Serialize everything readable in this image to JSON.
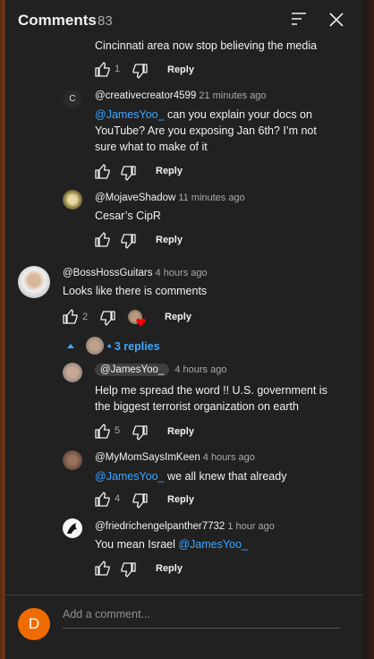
{
  "header": {
    "title": "Comments",
    "count": "83"
  },
  "comments": [
    {
      "text": "Cincinnati area now stop believing the media",
      "likes": "1",
      "reply": "Reply"
    },
    {
      "author": "@creativecreator4599",
      "time": "21 minutes ago",
      "mention": "@JamesYoo_",
      "text1": "can you explain your docs on",
      "text2": "YouTube? Are you exposing Jan 6th? I’m not",
      "text3": "sure what to make of it",
      "reply": "Reply",
      "avatar_letter": "C"
    },
    {
      "author": "@MojaveShadow",
      "time": "11 minutes ago",
      "text": "Cesar’s CipR",
      "reply": "Reply"
    },
    {
      "author": "@BossHossGuitars",
      "time": "4 hours ago",
      "text": "Looks like there is comments",
      "likes": "2",
      "reply": "Reply",
      "replies_label": "3 replies"
    },
    {
      "author_chip": "@JamesYoo_",
      "time": "4 hours ago",
      "text1": "Help me spread the word !! U.S. government is",
      "text2": "the biggest terrorist organization on earth",
      "likes": "5",
      "reply": "Reply"
    },
    {
      "author": "@MyMomSaysImKeen",
      "time": "4 hours ago",
      "mention": "@JamesYoo_",
      "text": "we all knew that already",
      "likes": "4",
      "reply": "Reply"
    },
    {
      "author": "@friedrichengelpanther7732",
      "time": "1 hour ago",
      "text": "You mean Israel",
      "mention": "@JamesYoo_",
      "reply": "Reply"
    }
  ],
  "footer": {
    "placeholder": "Add a comment...",
    "user_initial": "D"
  },
  "colors": {
    "accent": "#3ea6ff",
    "user_avatar": "#ef6c00",
    "panel": "#212121"
  }
}
